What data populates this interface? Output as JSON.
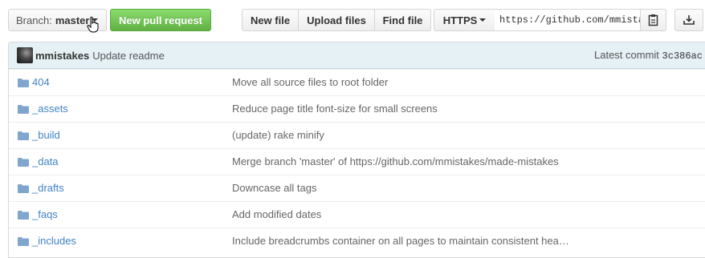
{
  "toolbar": {
    "branch_prefix": "Branch:",
    "branch_name": "master",
    "pull_request_label": "New pull request",
    "new_file_label": "New file",
    "upload_files_label": "Upload files",
    "find_file_label": "Find file",
    "protocol_label": "HTTPS",
    "clone_url": "https://github.com/mmistakes/made-mistakes.git",
    "copy_icon": "clipboard-icon",
    "download_icon": "download-icon"
  },
  "commit": {
    "author": "mmistakes",
    "message": "Update readme",
    "latest_label": "Latest commit",
    "sha": "3c386ac"
  },
  "files": [
    {
      "name": "404",
      "message": "Move all source files to root folder"
    },
    {
      "name": "_assets",
      "message": "Reduce page title font-size for small screens"
    },
    {
      "name": "_build",
      "message": "(update) rake minify"
    },
    {
      "name": "_data",
      "message": "Merge branch 'master' of https://github.com/mmistakes/made-mistakes"
    },
    {
      "name": "_drafts",
      "message": "Downcase all tags"
    },
    {
      "name": "_faqs",
      "message": "Add modified dates"
    },
    {
      "name": "_includes",
      "message": "Include breadcrumbs container on all pages to maintain consistent hea…"
    }
  ],
  "colors": {
    "link": "#4183c4",
    "primary_button": "#6cc644",
    "commit_bar": "#e6f1f6"
  }
}
